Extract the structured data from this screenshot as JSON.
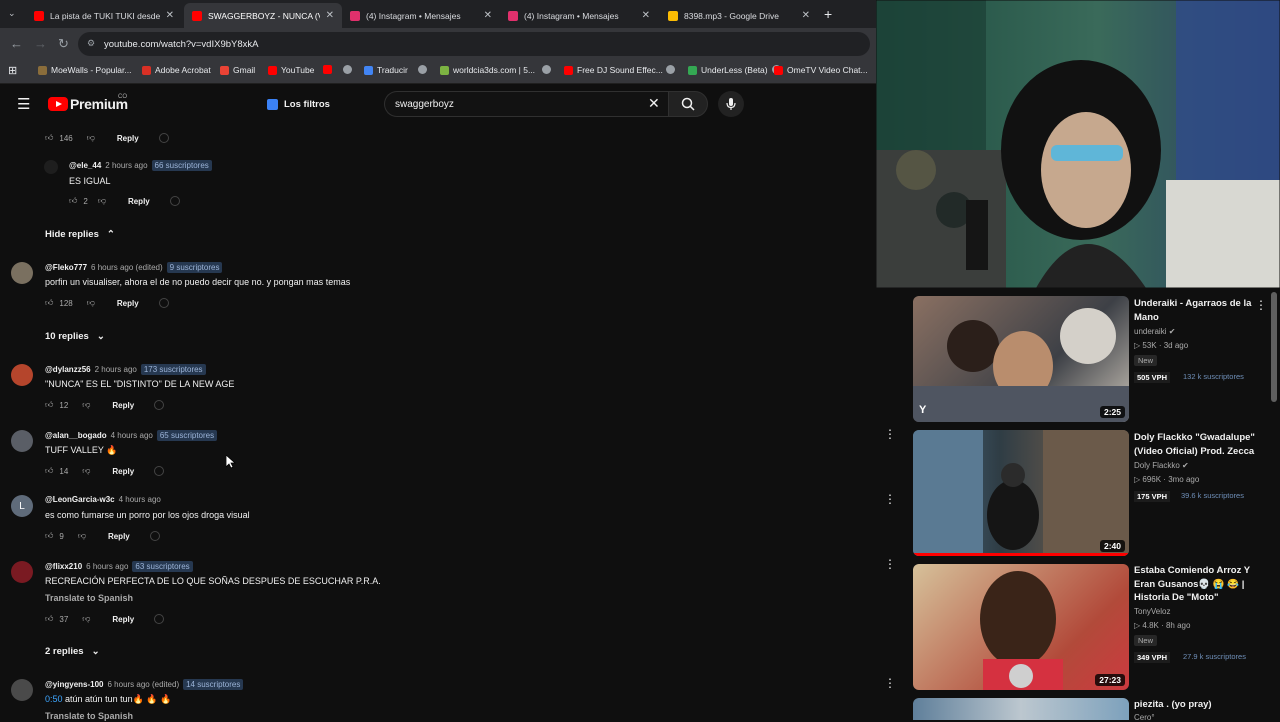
{
  "browser": {
    "tabs": [
      {
        "label": "La pista de TUKI TUKI desde ce",
        "favicon_color": "#ff0000",
        "active": false
      },
      {
        "label": "SWAGGERBOYZ - NUNCA (Vide",
        "favicon_color": "#ff0000",
        "active": true
      },
      {
        "label": "(4) Instagram • Mensajes",
        "favicon_color": "#e1306c",
        "active": false
      },
      {
        "label": "(4) Instagram • Mensajes",
        "favicon_color": "#e1306c",
        "active": false
      },
      {
        "label": "8398.mp3 - Google Drive",
        "favicon_color": "#fbbc04",
        "active": false
      }
    ],
    "new_tab": "+",
    "url": "youtube.com/watch?v=vdIX9bY8xkA",
    "bookmarks": [
      {
        "label": "MoeWalls - Popular...",
        "color": "#8a6d3b"
      },
      {
        "label": "Adobe Acrobat",
        "color": "#d93025"
      },
      {
        "label": "Gmail",
        "color": "#ea4335"
      },
      {
        "label": "YouTube",
        "color": "#ff0000"
      },
      {
        "label": "",
        "color": "#ff0000"
      },
      {
        "label": "",
        "color": "#9aa0a6"
      },
      {
        "label": "Traducir",
        "color": "#4285f4"
      },
      {
        "label": "",
        "color": "#9aa0a6"
      },
      {
        "label": "worldcia3ds.com | 5...",
        "color": "#7cb342"
      },
      {
        "label": "",
        "color": "#9aa0a6"
      },
      {
        "label": "Free DJ Sound Effec...",
        "color": "#ff0000"
      },
      {
        "label": "",
        "color": "#9aa0a6"
      },
      {
        "label": "UnderLess (Beta)",
        "color": "#34a853"
      },
      {
        "label": "",
        "color": "#9aa0a6"
      },
      {
        "label": "OmeTV Video Chat...",
        "color": "#ff0000"
      }
    ]
  },
  "youtube": {
    "logo_text": "Premium",
    "logo_country": "CO",
    "filters_label": "Los filtros",
    "search_value": "swaggerboyz"
  },
  "comments": [
    {
      "kind": "actions",
      "likes": "146",
      "reply": "Reply"
    },
    {
      "kind": "comment",
      "handle": "@ele_44",
      "time": "2 hours ago",
      "subs": "66 suscriptores",
      "text": "ES IGUAL",
      "likes": "2",
      "reply": "Reply"
    },
    {
      "kind": "toggle",
      "label": "Hide replies"
    },
    {
      "kind": "comment",
      "handle": "@Fleko777",
      "time": "6 hours ago (edited)",
      "subs": "9 suscriptores",
      "text": "porfin un visualiser, ahora el de no puedo decir que no. y pongan mas temas",
      "likes": "128",
      "reply": "Reply"
    },
    {
      "kind": "toggle",
      "label": "10 replies"
    },
    {
      "kind": "comment",
      "handle": "@dylanzz56",
      "time": "2 hours ago",
      "subs": "173 suscriptores",
      "text": "\"NUNCA\" ES EL \"DISTINTO\" DE LA NEW AGE",
      "likes": "12",
      "reply": "Reply"
    },
    {
      "kind": "comment",
      "handle": "@alan__bogado",
      "time": "4 hours ago",
      "subs": "65 suscriptores",
      "text": "TUFF VALLEY 🔥",
      "likes": "14",
      "reply": "Reply"
    },
    {
      "kind": "comment",
      "handle": "@LeonGarcia-w3c",
      "time": "4 hours ago",
      "subs": "",
      "text": "es como fumarse un porro por los ojos droga visual",
      "likes": "9",
      "reply": "Reply",
      "avatar_letter": "L"
    },
    {
      "kind": "comment",
      "handle": "@flixx210",
      "time": "6 hours ago",
      "subs": "63 suscriptores",
      "text": "RECREACIÓN PERFECTA DE LO QUE SOÑAS DESPUES DE ESCUCHAR P.R.A.",
      "translate": "Translate to Spanish",
      "likes": "37",
      "reply": "Reply"
    },
    {
      "kind": "toggle",
      "label": "2 replies"
    },
    {
      "kind": "comment",
      "handle": "@yingyens-100",
      "time": "6 hours ago (edited)",
      "subs": "14 suscriptores",
      "timestamp": "0:50",
      "text": " atún atún tun tun🔥 🔥 🔥",
      "translate": "Translate to Spanish"
    }
  ],
  "recommended": [
    {
      "title": "Underaiki - Agarraos de la Mano",
      "channel": "underaiki",
      "views": "53K",
      "age": "3d ago",
      "badge": "New",
      "vph": "505 VPH",
      "subs": "132 k suscriptores",
      "duration": "2:25"
    },
    {
      "title": "Doly Flackko \"Gwadalupe\" (Video Oficial) Prod. Zecca",
      "channel": "Doly Flackko",
      "views": "696K",
      "age": "3mo ago",
      "badge": "",
      "vph": "175 VPH",
      "subs": "39.6 k suscriptores",
      "duration": "2:40"
    },
    {
      "title": "Estaba Comiendo Arroz Y Eran Gusanos💀 😭 😂 | Historia De \"Moto\"",
      "channel": "TonyVeloz",
      "views": "4.8K",
      "age": "8h ago",
      "badge": "New",
      "vph": "349 VPH",
      "subs": "27.9 k suscriptores",
      "duration": "27:23"
    },
    {
      "title": "piezita .         (yo    pray)",
      "channel": "Cero°"
    }
  ]
}
